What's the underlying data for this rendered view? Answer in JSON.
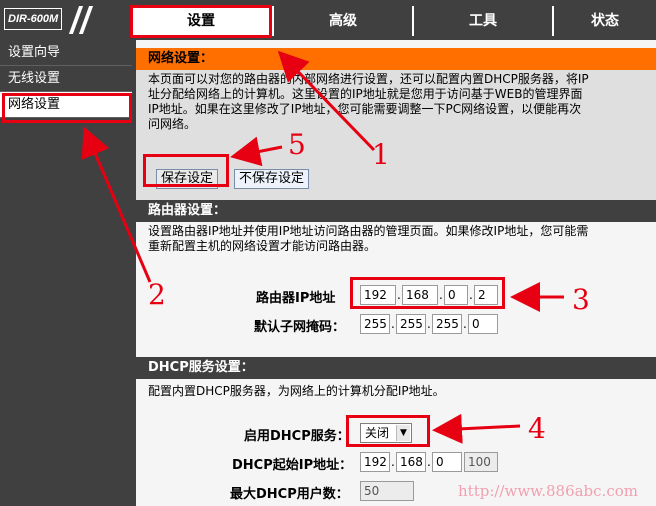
{
  "logo": "DIR-600M",
  "tabs": [
    "设置",
    "高级",
    "工具",
    "状态"
  ],
  "sidebar": [
    "设置向导",
    "无线设置",
    "网络设置"
  ],
  "network": {
    "title": "网络设置：",
    "desc": [
      "本页面可以对您的路由器的内部网络进行设置，还可以配置内置DHCP服务器，将IP",
      "址分配给网络上的计算机。这里设置的IP地址就是您用于访问基于WEB的管理界面",
      "IP地址。如果在这里修改了IP地址，您可能需要调整一下PC网络设置，以便能再次",
      "问网络。"
    ],
    "save": "保存设定",
    "nosave": "不保存设定"
  },
  "router": {
    "title": "路由器设置：",
    "desc": [
      "设置路由器IP地址并使用IP地址访问路由器的管理页面。如果修改IP地址，您可能需",
      "重新配置主机的网络设置才能访问路由器。"
    ],
    "ip_label": "路由器IP地址",
    "ip": [
      "192",
      "168",
      "0",
      "2"
    ],
    "mask_label": "默认子网掩码：",
    "mask": [
      "255",
      "255",
      "255",
      "0"
    ]
  },
  "dhcp": {
    "title": "DHCP服务设置：",
    "desc": "配置内置DHCP服务器，为网络上的计算机分配IP地址。",
    "enable_label": "启用DHCP服务：",
    "enable_value": "关闭",
    "start_label": "DHCP起始IP地址：",
    "start": [
      "192",
      "168",
      "0",
      "100"
    ],
    "max_label": "最大DHCP用户数：",
    "max_value": "50"
  },
  "annotations": [
    "1",
    "2",
    "3",
    "4",
    "5"
  ],
  "watermark": "http://www.886abc.com",
  "colors": {
    "header_orange": "#ff6f00",
    "highlight_red": "#e60012",
    "dark": "#404040"
  }
}
